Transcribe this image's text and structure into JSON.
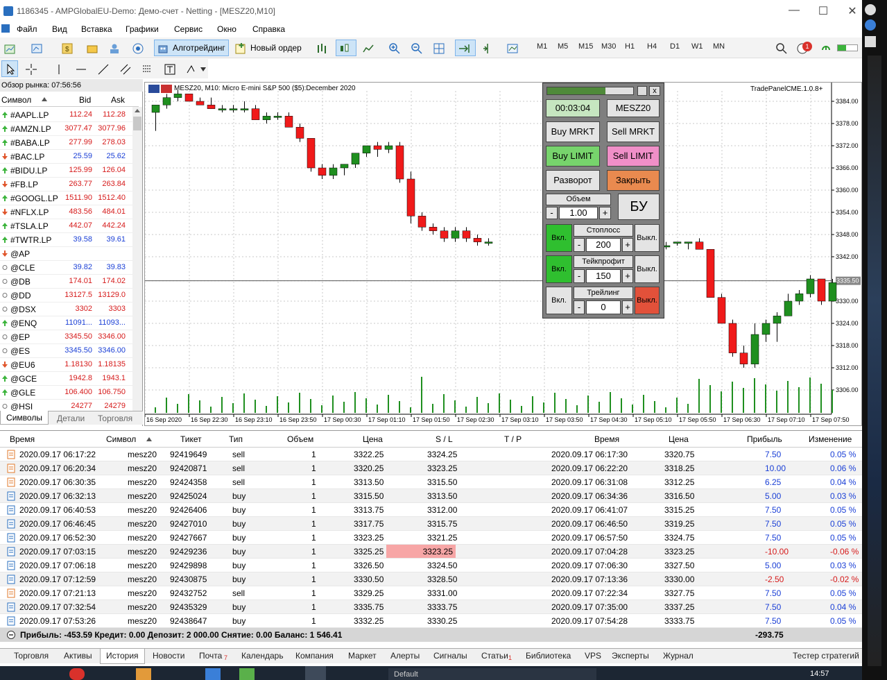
{
  "window": {
    "title": "1186345 - AMPGlobalEU-Demo: Демо-счет - Netting - [MESZ20,M10]",
    "minimize": "—",
    "maximize": "☐",
    "close": "✕"
  },
  "menu": [
    "Файл",
    "Вид",
    "Вставка",
    "Графики",
    "Сервис",
    "Окно",
    "Справка"
  ],
  "toolbar": {
    "algo_label": "Алготрейдинг",
    "new_order_label": "Новый ордер",
    "timeframes": [
      "M1",
      "M5",
      "M15",
      "M30",
      "H1",
      "H4",
      "D1",
      "W1",
      "MN"
    ],
    "notify_count": "1"
  },
  "market_watch": {
    "title": "Обзор рынка: 07:56:56",
    "col_symbol": "Символ",
    "col_bid": "Bid",
    "col_ask": "Ask",
    "rows": [
      {
        "symbol": "#AAPL.LP",
        "bid": "112.24",
        "ask": "112.28",
        "dir": "up",
        "color": "red"
      },
      {
        "symbol": "#AMZN.LP",
        "bid": "3077.47",
        "ask": "3077.96",
        "dir": "up",
        "color": "red"
      },
      {
        "symbol": "#BABA.LP",
        "bid": "277.99",
        "ask": "278.03",
        "dir": "up",
        "color": "red"
      },
      {
        "symbol": "#BAC.LP",
        "bid": "25.59",
        "ask": "25.62",
        "dir": "down",
        "color": "blue"
      },
      {
        "symbol": "#BIDU.LP",
        "bid": "125.99",
        "ask": "126.04",
        "dir": "up",
        "color": "red"
      },
      {
        "symbol": "#FB.LP",
        "bid": "263.77",
        "ask": "263.84",
        "dir": "down",
        "color": "red"
      },
      {
        "symbol": "#GOOGL.LP",
        "bid": "1511.90",
        "ask": "1512.40",
        "dir": "up",
        "color": "red"
      },
      {
        "symbol": "#NFLX.LP",
        "bid": "483.56",
        "ask": "484.01",
        "dir": "down",
        "color": "red"
      },
      {
        "symbol": "#TSLA.LP",
        "bid": "442.07",
        "ask": "442.24",
        "dir": "up",
        "color": "red"
      },
      {
        "symbol": "#TWTR.LP",
        "bid": "39.58",
        "ask": "39.61",
        "dir": "up",
        "color": "blue"
      },
      {
        "symbol": "@AP",
        "bid": "",
        "ask": "",
        "dir": "down",
        "color": "black"
      },
      {
        "symbol": "@CLE",
        "bid": "39.82",
        "ask": "39.83",
        "dir": "none",
        "color": "blue"
      },
      {
        "symbol": "@DB",
        "bid": "174.01",
        "ask": "174.02",
        "dir": "none",
        "color": "red"
      },
      {
        "symbol": "@DD",
        "bid": "13127.5",
        "ask": "13129.0",
        "dir": "none",
        "color": "red"
      },
      {
        "symbol": "@DSX",
        "bid": "3302",
        "ask": "3303",
        "dir": "none",
        "color": "red"
      },
      {
        "symbol": "@ENQ",
        "bid": "11091...",
        "ask": "11093...",
        "dir": "up",
        "color": "blue"
      },
      {
        "symbol": "@EP",
        "bid": "3345.50",
        "ask": "3346.00",
        "dir": "none",
        "color": "red"
      },
      {
        "symbol": "@ES",
        "bid": "3345.50",
        "ask": "3346.00",
        "dir": "none",
        "color": "blue"
      },
      {
        "symbol": "@EU6",
        "bid": "1.18130",
        "ask": "1.18135",
        "dir": "down",
        "color": "red"
      },
      {
        "symbol": "@GCE",
        "bid": "1942.8",
        "ask": "1943.1",
        "dir": "up",
        "color": "red"
      },
      {
        "symbol": "@GLE",
        "bid": "106.400",
        "ask": "106.750",
        "dir": "up",
        "color": "red"
      },
      {
        "symbol": "@HSI",
        "bid": "24277",
        "ask": "24279",
        "dir": "none",
        "color": "red"
      }
    ],
    "tabs": [
      "Символы",
      "Детали",
      "Торговля"
    ]
  },
  "chart": {
    "header": "MESZ20, M10:  Micro E-mini S&P 500 ($5):December 2020",
    "indicator_label": "TradePanelCME.1.0.8+",
    "price_labels": [
      "3384.00",
      "3378.00",
      "3372.00",
      "3366.00",
      "3360.00",
      "3354.00",
      "3348.00",
      "3342.00",
      "3335.50",
      "3330.00",
      "3324.00",
      "3318.00",
      "3312.00",
      "3306.00"
    ],
    "time_labels": [
      "16 Sep 2020",
      "16 Sep 22:30",
      "16 Sep 23:10",
      "16 Sep 23:50",
      "17 Sep 00:30",
      "17 Sep 01:10",
      "17 Sep 01:50",
      "17 Sep 02:30",
      "17 Sep 03:10",
      "17 Sep 03:50",
      "17 Sep 04:30",
      "17 Sep 05:10",
      "17 Sep 05:50",
      "17 Sep 06:30",
      "17 Sep 07:10",
      "17 Sep 07:50"
    ],
    "current_price": "3335.50"
  },
  "panel": {
    "timer": "00:03:04",
    "symbol": "MESZ20",
    "buy_market": "Buy MRKT",
    "sell_market": "Sell MRKT",
    "buy_limit": "Buy LIMIT",
    "sell_limit": "Sell LIMIT",
    "reverse": "Разворот",
    "close": "Закрыть",
    "volume_label": "Объем",
    "volume_value": "1.00",
    "breakeven": "БУ",
    "minus": "-",
    "plus": "+",
    "on": "Вкл.",
    "off": "Выкл.",
    "stoploss_label": "Стоплосс",
    "stoploss_value": "200",
    "takeprofit_label": "Тейкпрофит",
    "takeprofit_value": "150",
    "trailing_label": "Трейлинг",
    "trailing_value": "0"
  },
  "history": {
    "columns": [
      "Время",
      "Символ",
      "Тикет",
      "Тип",
      "Объем",
      "Цена",
      "S / L",
      "T / P",
      "Время",
      "Цена",
      "Прибыль",
      "Изменение"
    ],
    "rows": [
      [
        "2020.09.17 06:17:22",
        "mesz20",
        "92419649",
        "sell",
        "1",
        "3322.25",
        "3324.25",
        "",
        "2020.09.17 06:17:30",
        "3320.75",
        "7.50",
        "0.05 %"
      ],
      [
        "2020.09.17 06:20:34",
        "mesz20",
        "92420871",
        "sell",
        "1",
        "3320.25",
        "3323.25",
        "",
        "2020.09.17 06:22:20",
        "3318.25",
        "10.00",
        "0.06 %"
      ],
      [
        "2020.09.17 06:30:35",
        "mesz20",
        "92424358",
        "sell",
        "1",
        "3313.50",
        "3315.50",
        "",
        "2020.09.17 06:31:08",
        "3312.25",
        "6.25",
        "0.04 %"
      ],
      [
        "2020.09.17 06:32:13",
        "mesz20",
        "92425024",
        "buy",
        "1",
        "3315.50",
        "3313.50",
        "",
        "2020.09.17 06:34:36",
        "3316.50",
        "5.00",
        "0.03 %"
      ],
      [
        "2020.09.17 06:40:53",
        "mesz20",
        "92426406",
        "buy",
        "1",
        "3313.75",
        "3312.00",
        "",
        "2020.09.17 06:41:07",
        "3315.25",
        "7.50",
        "0.05 %"
      ],
      [
        "2020.09.17 06:46:45",
        "mesz20",
        "92427010",
        "buy",
        "1",
        "3317.75",
        "3315.75",
        "",
        "2020.09.17 06:46:50",
        "3319.25",
        "7.50",
        "0.05 %"
      ],
      [
        "2020.09.17 06:52:30",
        "mesz20",
        "92427667",
        "buy",
        "1",
        "3323.25",
        "3321.25",
        "",
        "2020.09.17 06:57:50",
        "3324.75",
        "7.50",
        "0.05 %"
      ],
      [
        "2020.09.17 07:03:15",
        "mesz20",
        "92429236",
        "buy",
        "1",
        "3325.25",
        "3323.25",
        "",
        "2020.09.17 07:04:28",
        "3323.25",
        "-10.00",
        "-0.06 %"
      ],
      [
        "2020.09.17 07:06:18",
        "mesz20",
        "92429898",
        "buy",
        "1",
        "3326.50",
        "3324.50",
        "",
        "2020.09.17 07:06:30",
        "3327.50",
        "5.00",
        "0.03 %"
      ],
      [
        "2020.09.17 07:12:59",
        "mesz20",
        "92430875",
        "buy",
        "1",
        "3330.50",
        "3328.50",
        "",
        "2020.09.17 07:13:36",
        "3330.00",
        "-2.50",
        "-0.02 %"
      ],
      [
        "2020.09.17 07:21:13",
        "mesz20",
        "92432752",
        "sell",
        "1",
        "3329.25",
        "3331.00",
        "",
        "2020.09.17 07:22:34",
        "3327.75",
        "7.50",
        "0.05 %"
      ],
      [
        "2020.09.17 07:32:54",
        "mesz20",
        "92435329",
        "buy",
        "1",
        "3335.75",
        "3333.75",
        "",
        "2020.09.17 07:35:00",
        "3337.25",
        "7.50",
        "0.04 %"
      ],
      [
        "2020.09.17 07:53:26",
        "mesz20",
        "92438647",
        "buy",
        "1",
        "3332.25",
        "3330.25",
        "",
        "2020.09.17 07:54:28",
        "3333.75",
        "7.50",
        "0.05 %"
      ]
    ],
    "summary": "Прибыль: -453.59  Кредит: 0.00  Депозит: 2 000.00  Снятие: 0.00  Баланс: 1 546.41",
    "summary_total": "-293.75"
  },
  "bottom_tabs": [
    "Торговля",
    "Активы",
    "История",
    "Новости",
    "Почта",
    "Календарь",
    "Компания",
    "Маркет",
    "Алерты",
    "Сигналы",
    "Статьи",
    "Библиотека",
    "VPS",
    "Эксперты",
    "Журнал"
  ],
  "bottom_tabs_right": "Тестер стратегий",
  "mail_badge": "7",
  "articles_badge": "1",
  "taskbar": {
    "time": "14:57",
    "default_label": "Default"
  }
}
